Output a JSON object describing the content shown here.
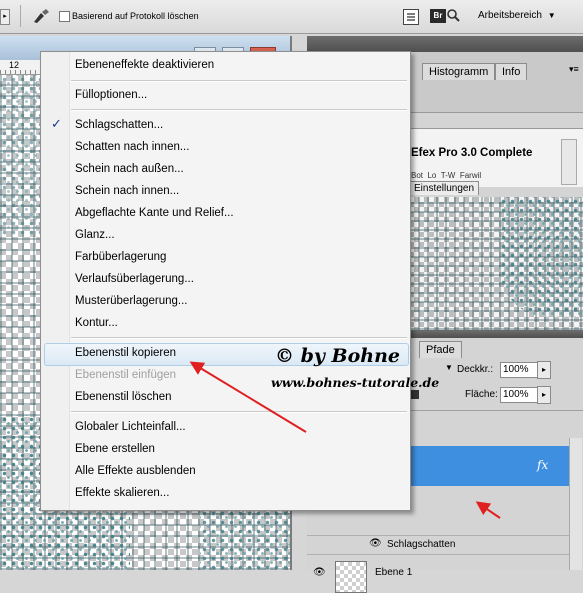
{
  "options_bar": {
    "protocol_label": "Basierend auf Protokoll löschen",
    "workspace_label": "Arbeitsbereich",
    "bridge_label": "Br"
  },
  "document": {
    "ruler_tick": "12"
  },
  "panels": {
    "top_tabs": [
      "Histogramm",
      "Info"
    ],
    "plugin_title": "Efex Pro 3.0 Complete",
    "plugin_tab_items": [
      "Bot",
      "Lo",
      "T-W",
      "Farwil"
    ],
    "settings_tab": "Einstellungen",
    "layers_tab": "Pfade",
    "opacity_label": "Deckkr.:",
    "opacity_value": "100%",
    "fill_label": "Fläche:",
    "fill_value": "100%",
    "fx_label": "fx",
    "effect_name": "Schlagschatten",
    "layer_name": "Ebene 1"
  },
  "context_menu": {
    "items": [
      "Ebeneneffekte deaktivieren",
      "Fülloptionen...",
      "Schlagschatten...",
      "Schatten nach innen...",
      "Schein nach außen...",
      "Schein nach innen...",
      "Abgeflachte Kante und Relief...",
      "Glanz...",
      "Farbüberlagerung",
      "Verlaufsüberlagerung...",
      "Musterüberlagerung...",
      "Kontur...",
      "Ebenenstil kopieren",
      "Ebenenstil einfügen",
      "Ebenenstil löschen",
      "Globaler Lichteinfall...",
      "Ebene erstellen",
      "Alle Effekte ausblenden",
      "Effekte skalieren..."
    ],
    "checked_item": "Schlagschatten...",
    "highlighted_item": "Ebenenstil kopieren",
    "disabled_item": "Ebenenstil einfügen",
    "check_glyph": "✓"
  },
  "watermark": {
    "line1": "© by Bohne",
    "line2": "www.bohnes-tutorale.de"
  },
  "colors": {
    "arrow": "#e02020",
    "selected_layer": "#3f8fe0",
    "menu_highlight": "#dbe9f5"
  }
}
